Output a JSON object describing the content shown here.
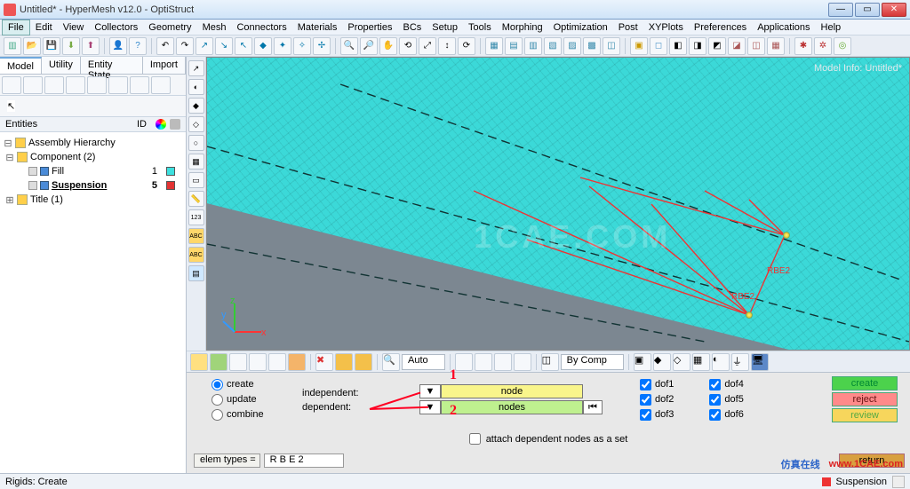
{
  "window": {
    "title": "Untitled* - HyperMesh v12.0 - OptiStruct"
  },
  "menu": {
    "items": [
      "File",
      "Edit",
      "View",
      "Collectors",
      "Geometry",
      "Mesh",
      "Connectors",
      "Materials",
      "Properties",
      "BCs",
      "Setup",
      "Tools",
      "Morphing",
      "Optimization",
      "Post",
      "XYPlots",
      "Preferences",
      "Applications",
      "Help"
    ]
  },
  "tabs": {
    "items": [
      "Model",
      "Utility",
      "Entity State",
      "Import"
    ],
    "active": 0
  },
  "tree": {
    "header_entities": "Entities",
    "header_id": "ID",
    "assembly": "Assembly Hierarchy",
    "component_group": "Component (2)",
    "fill": {
      "name": "Fill",
      "id": "1",
      "color": "#3de0df"
    },
    "suspension": {
      "name": "Suspension",
      "id": "5",
      "color": "#e33333"
    },
    "title_group": "Title (1)"
  },
  "viewport": {
    "model_info": "Model Info: Untitled*",
    "watermark": "1CAE.COM",
    "rbe2_a": "RBE2",
    "rbe2_b": "RBE2",
    "axes": {
      "x": "x",
      "y": "y",
      "z": "z"
    }
  },
  "gfxbar": {
    "auto": "Auto",
    "bycomp": "By Comp"
  },
  "panel": {
    "radios": {
      "create": "create",
      "update": "update",
      "combine": "combine"
    },
    "independent": "independent:",
    "dependent": "dependent:",
    "node": "node",
    "nodes": "nodes",
    "dofs": {
      "dof1": "dof1",
      "dof2": "dof2",
      "dof3": "dof3",
      "dof4": "dof4",
      "dof5": "dof5",
      "dof6": "dof6"
    },
    "attach": "attach dependent nodes as a set",
    "elem_types": "elem types =",
    "elem_value": "R B E 2",
    "actions": {
      "create": "create",
      "reject": "reject",
      "review": "review",
      "return": "return"
    },
    "annot1": "1",
    "annot2": "2"
  },
  "status": {
    "left": "Rigids: Create",
    "comp": "Suspension"
  },
  "footer": {
    "cn": "仿真在线",
    "url": "www.1CAE.com"
  }
}
